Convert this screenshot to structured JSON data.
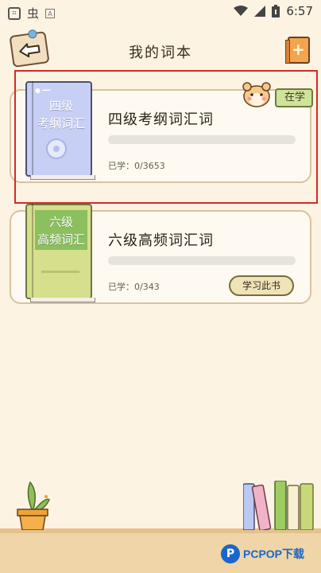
{
  "status_bar": {
    "left_icons": [
      "app-icon",
      "bug-icon",
      "a-icon"
    ],
    "chinese_glyph": "虫",
    "time": "6:57",
    "right_icons": [
      "wifi-icon",
      "signal-icon",
      "battery-icon"
    ]
  },
  "header": {
    "title": "我的词本",
    "back_icon": "back-arrow-icon",
    "add_icon": "add-book-icon"
  },
  "books": [
    {
      "cover_title_line1": "四级",
      "cover_title_line2": "考纲词汇",
      "name": "四级考纲词汇词",
      "learned": "已学：0/3653",
      "progress": 0,
      "badge": "在学",
      "cover_color": "#c8cff4"
    },
    {
      "cover_title_line1": "六级",
      "cover_title_line2": "高频词汇",
      "name": "六级高频词汇词",
      "learned": "已学：0/343",
      "progress": 0,
      "action": "学习此书",
      "cover_color": "#d5df8c"
    }
  ],
  "watermark": {
    "logo": "P",
    "text": "PCPOP下载"
  }
}
